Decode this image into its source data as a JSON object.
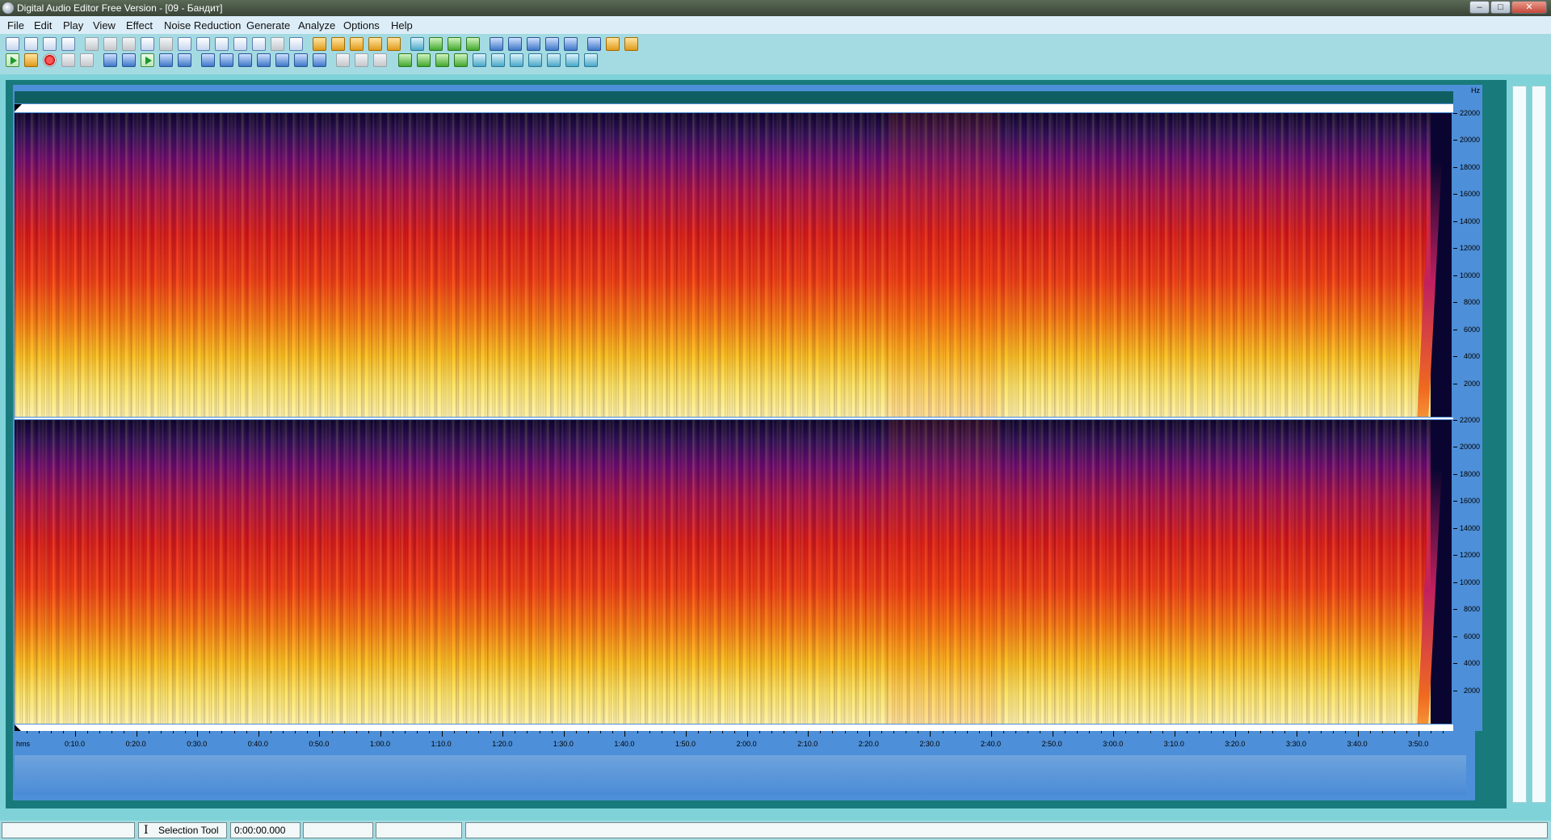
{
  "window": {
    "title": "Digital Audio Editor Free Version - [09 - Бандит]",
    "controls": [
      {
        "name": "minimize",
        "glyph": "–"
      },
      {
        "name": "maximize",
        "glyph": "□"
      },
      {
        "name": "close",
        "glyph": "✕"
      }
    ]
  },
  "menu": [
    "File",
    "Edit",
    "Play",
    "View",
    "Effect",
    "Noise Reduction",
    "Generate",
    "Analyze",
    "Options",
    "Help"
  ],
  "toolbar_row1": [
    "new-file-icon",
    "open-file-icon",
    "save-icon",
    "save-all-icon",
    "undo-icon",
    "redo-icon",
    "undo-history-icon",
    "copy-icon",
    "cut-icon",
    "paste-icon",
    "paste-mix-icon",
    "delete-icon",
    "trim-icon",
    "select-all-icon",
    "insert-silence-icon",
    "crop-icon",
    "fade-in-icon",
    "fade-out-icon",
    "normalize-icon",
    "amplify-icon",
    "reverse-icon",
    "settings-icon",
    "equalizer-icon",
    "echo-icon",
    "reverb-icon",
    "record-mic-icon",
    "cd-icon",
    "convert-icon",
    "noise-icon",
    "filter-icon",
    "music-note-icon",
    "effects-icon",
    "plugin-icon"
  ],
  "toolbar_row2": [
    "play-icon",
    "loop-icon",
    "record-icon",
    "pause-icon",
    "stop-icon",
    "go-start-icon",
    "rewind-icon",
    "play-selection-icon",
    "fast-forward-icon",
    "go-end-icon",
    "zoom-in-icon",
    "zoom-out-icon",
    "zoom-selection-icon",
    "zoom-vertical-in-icon",
    "zoom-vertical-out-icon",
    "zoom-full-icon",
    "zoom-fit-icon",
    "snap-icon",
    "sync-icon",
    "marker-icon",
    "pitch-up-icon",
    "pitch-down-icon",
    "tempo-icon",
    "bass-boost-icon",
    "envelope-icon",
    "stretch-icon",
    "vibrato-icon",
    "flanger-icon",
    "chorus-icon",
    "phaser-icon",
    "spectrum-icon"
  ],
  "spectrogram": {
    "freq_unit": "Hz",
    "freq_ticks": [
      "22000",
      "20000",
      "18000",
      "16000",
      "14000",
      "12000",
      "10000",
      "8000",
      "6000",
      "4000",
      "2000"
    ],
    "channels": 2
  },
  "timeline": {
    "unit": "hms",
    "labels": [
      "0:10.0",
      "0:20.0",
      "0:30.0",
      "0:40.0",
      "0:50.0",
      "1:00.0",
      "1:10.0",
      "1:20.0",
      "1:30.0",
      "1:40.0",
      "1:50.0",
      "2:00.0",
      "2:10.0",
      "2:20.0",
      "2:30.0",
      "2:40.0",
      "2:50.0",
      "3:00.0",
      "3:10.0",
      "3:20.0",
      "3:30.0",
      "3:40.0",
      "3:50.0"
    ]
  },
  "status": {
    "tool": "Selection Tool",
    "position": "0:00:00.000",
    "empty1": "",
    "empty2": "",
    "empty3": "",
    "empty4": ""
  }
}
